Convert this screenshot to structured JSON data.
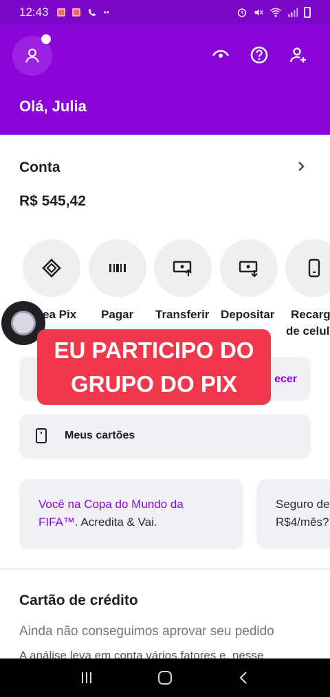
{
  "status_bar": {
    "time": "12:43",
    "left_icons": [
      "sim-icon",
      "sim-icon",
      "phone-icon",
      "more-dots-icon"
    ],
    "right_icons": [
      "alarm-icon",
      "mute-icon",
      "wifi-icon",
      "signal-icon",
      "battery-icon"
    ]
  },
  "header": {
    "greeting": "Olá, Julia",
    "background_color": "#8a05d8",
    "icons": [
      "eye-icon",
      "help-icon",
      "add-user-icon"
    ]
  },
  "account": {
    "title": "Conta",
    "balance": "R$ 545,42"
  },
  "actions": [
    {
      "label": "Área Pix",
      "icon": "pix-icon"
    },
    {
      "label": "Pagar",
      "icon": "barcode-icon"
    },
    {
      "label": "Transferir",
      "icon": "transfer-icon"
    },
    {
      "label": "Depositar",
      "icon": "deposit-icon"
    },
    {
      "label": "Recarga de celular",
      "icon": "phone-icon"
    }
  ],
  "action_labels_visible": {
    "pix": "ea Pix",
    "recarga_line1": "Recarg",
    "recarga_line2": "de celul"
  },
  "promo_card_link": "ecer",
  "my_cards": {
    "label": "Meus cartões"
  },
  "overlay": {
    "line1": "EU PARTICIPO DO",
    "line2": "GRUPO DO PIX",
    "color": "#f0374c"
  },
  "promos": [
    {
      "highlight": "Você na Copa do Mundo da FIFA™.",
      "text": " Acredita & Vai.",
      "highlight_a": "Você na Copa do Mundo da",
      "highlight_b": "FIFA™.",
      "text_b": " Acredita & Vai."
    },
    {
      "line1": "Seguro de",
      "line2": "R$4/mês?"
    }
  ],
  "credit_card": {
    "title": "Cartão de crédito",
    "subtitle": "Ainda não conseguimos aprovar seu pedido",
    "detail": "A análise leva em conta vários fatores e, nesse"
  }
}
